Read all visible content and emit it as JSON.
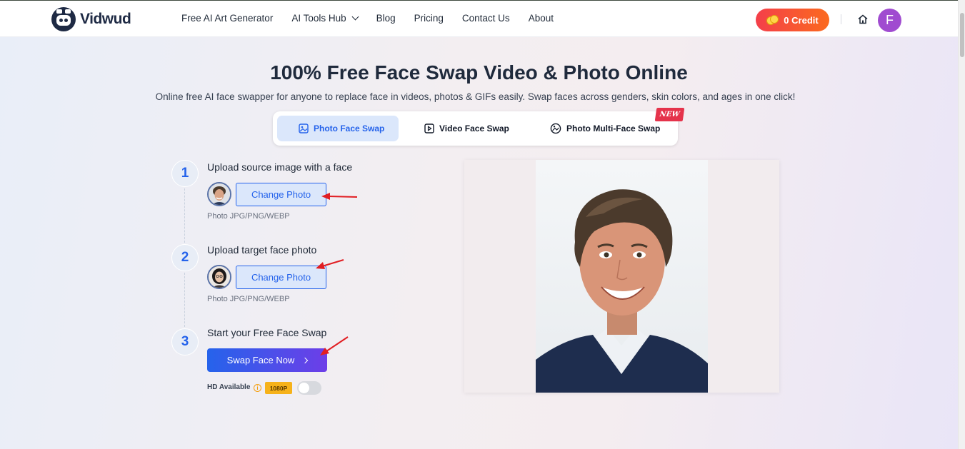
{
  "brand": {
    "name": "Vidwud"
  },
  "nav": {
    "items": [
      "Free AI Art Generator",
      "AI Tools Hub",
      "Blog",
      "Pricing",
      "Contact Us",
      "About"
    ]
  },
  "header": {
    "credit_label": "0 Credit",
    "user_initial": "F"
  },
  "hero": {
    "title": "100% Free Face Swap Video & Photo Online",
    "subtitle": "Online free AI face swapper for anyone to replace face in videos, photos & GIFs easily. Swap faces across genders, skin colors, and ages in one click!"
  },
  "tabs": [
    {
      "label": "Photo Face Swap",
      "active": true
    },
    {
      "label": "Video Face Swap",
      "active": false
    },
    {
      "label": "Photo Multi-Face Swap",
      "active": false
    }
  ],
  "new_badge": "NEW",
  "steps": [
    {
      "num": "1",
      "title": "Upload source image with a face",
      "button": "Change Photo",
      "hint": "Photo JPG/PNG/WEBP"
    },
    {
      "num": "2",
      "title": "Upload target face photo",
      "button": "Change Photo",
      "hint": "Photo JPG/PNG/WEBP"
    },
    {
      "num": "3",
      "title": "Start your Free Face Swap",
      "button": "Swap Face Now"
    }
  ],
  "hd": {
    "label": "HD Available",
    "info": "i",
    "badge": "1080P",
    "enabled": false
  },
  "colors": {
    "accent": "#2563eb",
    "credit": "#f43f4a",
    "annotation": "#e11d22"
  }
}
